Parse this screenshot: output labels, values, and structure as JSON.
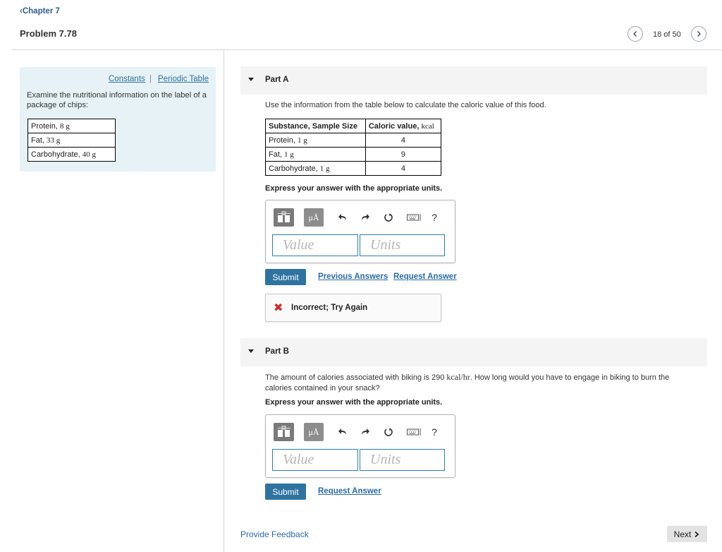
{
  "header": {
    "back_label": "Chapter 7",
    "problem_title": "Problem 7.78",
    "pager_count": "18 of 50"
  },
  "info_panel": {
    "constants_link": "Constants",
    "separator": "|",
    "periodic_table_link": "Periodic Table",
    "text": "Examine the nutritional information on the label of a package of chips:",
    "label_rows": [
      {
        "name": "Protein, ",
        "amount": "8 g"
      },
      {
        "name": "Fat, ",
        "amount": "33 g"
      },
      {
        "name": "Carbohydrate, ",
        "amount": "40 g"
      }
    ]
  },
  "part_a": {
    "title": "Part A",
    "prompt": "Use the information from the table below to calculate the caloric value of this food.",
    "table": {
      "header_substance": "Substance, Sample Size",
      "header_caloric": "Caloric value, ",
      "header_unit": "kcal",
      "rows": [
        {
          "name": "Protein, ",
          "amount": "1 g",
          "value": "4"
        },
        {
          "name": "Fat, ",
          "amount": "1 g",
          "value": "9"
        },
        {
          "name": "Carbohydrate, ",
          "amount": "1 g",
          "value": "4"
        }
      ]
    },
    "instruction": "Express your answer with the appropriate units.",
    "value_placeholder": "Value",
    "units_placeholder": "Units",
    "submit_label": "Submit",
    "previous_answers_label": "Previous Answers",
    "request_answer_label": "Request Answer",
    "feedback": "Incorrect; Try Again"
  },
  "part_b": {
    "title": "Part B",
    "prompt_before": "The amount of calories associated with biking is 290 ",
    "prompt_unit": "kcal/hr",
    "prompt_after": ". How long would you have to engage in biking to burn the calories contained in your snack?",
    "instruction": "Express your answer with the appropriate units.",
    "value_placeholder": "Value",
    "units_placeholder": "Units",
    "submit_label": "Submit",
    "request_answer_label": "Request Answer"
  },
  "toolbar": {
    "mu_label": "μÅ",
    "help_label": "?"
  },
  "footer": {
    "provide_feedback": "Provide Feedback",
    "next_label": "Next"
  },
  "colors": {
    "accent": "#2f73a1",
    "info_panel_bg": "#e6f2f5",
    "error": "#cf2b2b"
  }
}
